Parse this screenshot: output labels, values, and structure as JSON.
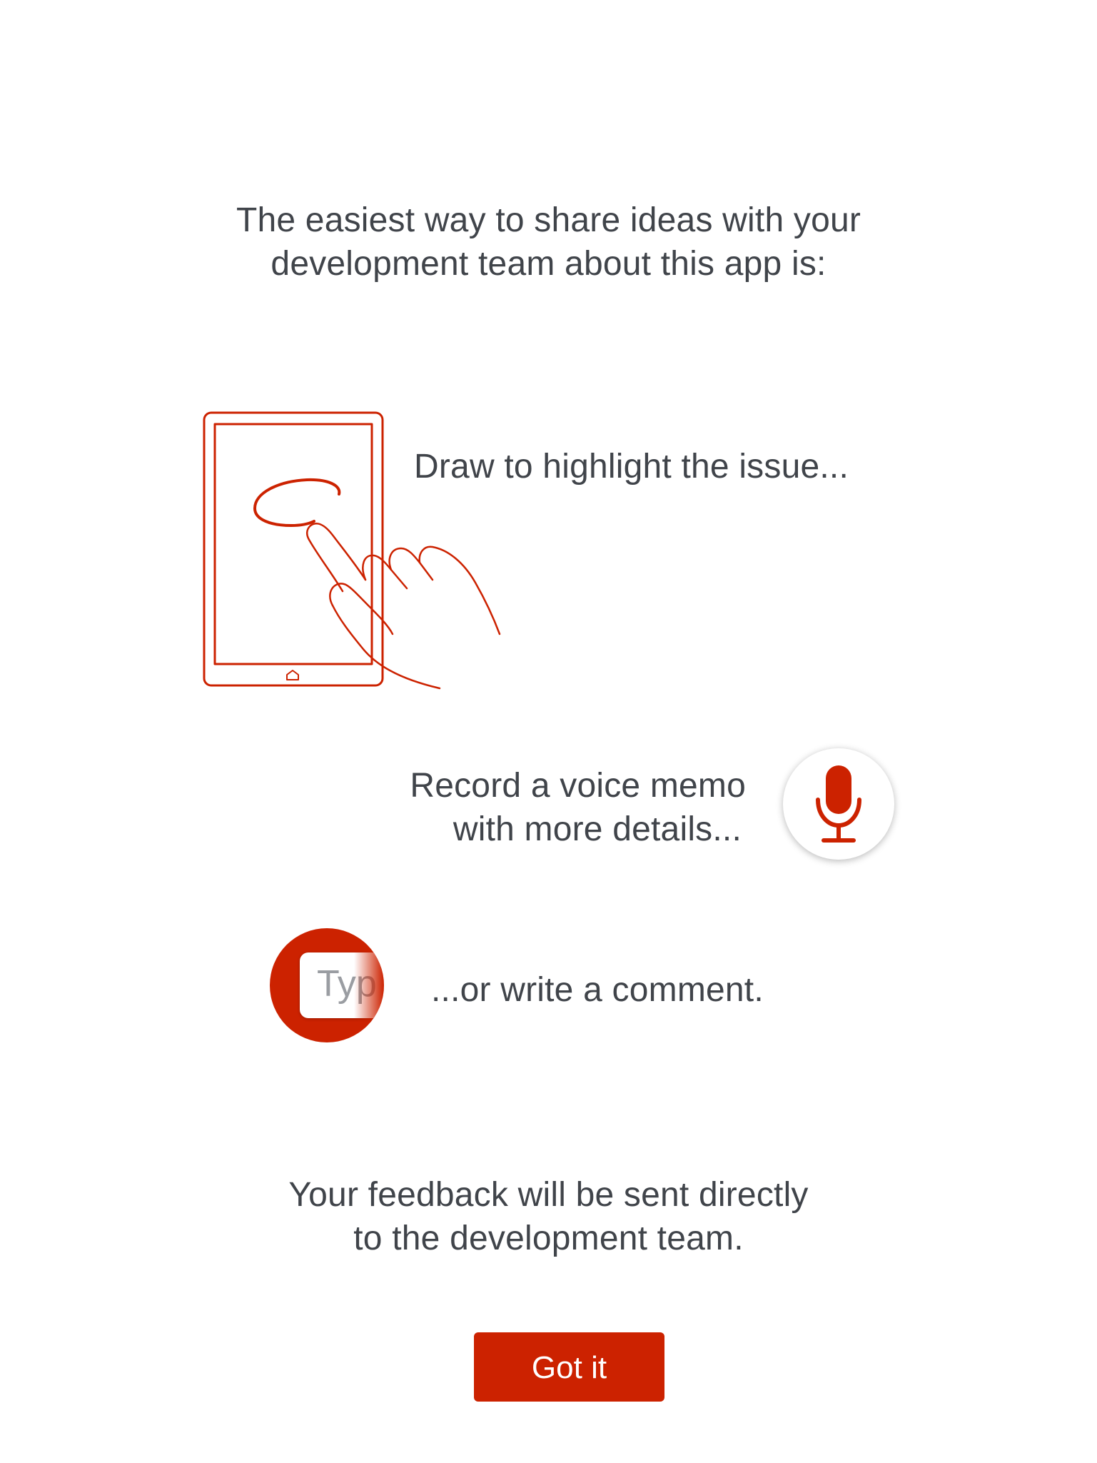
{
  "intro": {
    "line1": "The easiest way to share ideas with your",
    "line2": "development team about this app is:"
  },
  "draw": {
    "label": "Draw to highlight the issue...",
    "icon": "tablet-drawing-hand-icon"
  },
  "voice": {
    "line1": "Record a voice memo",
    "line2": "with more details...",
    "icon": "microphone-icon"
  },
  "comment": {
    "label": "...or write a comment.",
    "field_text": "Typ",
    "icon": "text-field-icon"
  },
  "footer": {
    "line1": "Your feedback will be sent directly",
    "line2": "to the development team."
  },
  "button": {
    "label": "Got it"
  },
  "colors": {
    "accent": "#cc2200",
    "text": "#40444a",
    "background": "#ffffff"
  }
}
